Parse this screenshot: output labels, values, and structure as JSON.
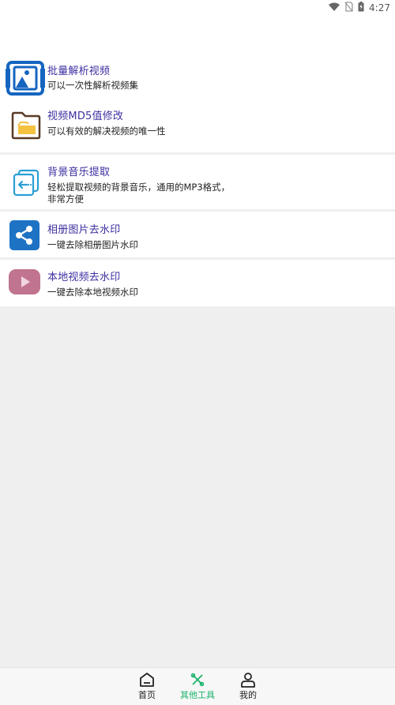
{
  "status": {
    "time": "4:27"
  },
  "items": [
    {
      "title": "批量解析视频",
      "subtitle": "可以一次性解析视频集",
      "icon": "gallery-icon"
    },
    {
      "title": "视频MD5值修改",
      "subtitle": "可以有效的解决视频的唯一性",
      "icon": "folder-icon"
    },
    {
      "title": "背景音乐提取",
      "subtitle": "轻松提取视频的背景音乐，通用的MP3格式，",
      "subtitle2": "非常方便",
      "icon": "extract-icon"
    },
    {
      "title": "相册图片去水印",
      "subtitle": "一键去除相册图片水印",
      "icon": "share-icon"
    },
    {
      "title": "本地视频去水印",
      "subtitle": "一键去除本地视频水印",
      "icon": "play-icon"
    }
  ],
  "tabs": [
    {
      "label": "首页",
      "icon": "home-icon"
    },
    {
      "label": "其他工具",
      "icon": "tools-icon",
      "active": true
    },
    {
      "label": "我的",
      "icon": "profile-icon"
    }
  ],
  "colors": {
    "accent": "#19b36b",
    "title": "#3b2fa0",
    "blue": "#1565c0"
  }
}
